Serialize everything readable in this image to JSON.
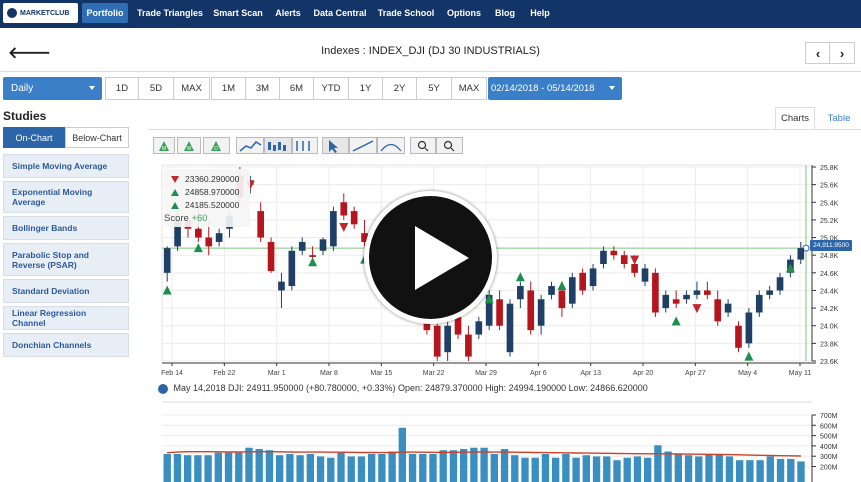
{
  "nav": {
    "logo": "MARKETCLUB",
    "items": [
      "Portfolio",
      "Trade Triangles",
      "Smart Scan",
      "Alerts",
      "Data Central",
      "Trade School",
      "Options",
      "Blog",
      "Help"
    ]
  },
  "header": {
    "title": "Indexes : INDEX_DJI (DJ 30 INDUSTRIALS)",
    "back_glyph": "🡐",
    "prev_glyph": "‹",
    "next_glyph": "›"
  },
  "range": {
    "period": "Daily",
    "buttons": [
      "1D",
      "5D",
      "MAX",
      "1M",
      "3M",
      "6M",
      "YTD",
      "1Y",
      "2Y",
      "5Y",
      "MAX"
    ],
    "date_range": "02/14/2018 - 05/14/2018"
  },
  "studies": {
    "title": "Studies",
    "tabs": [
      "On-Chart",
      "Below-Chart"
    ],
    "items": [
      "Simple Moving Average",
      "Exponential Moving Average",
      "Bollinger Bands",
      "Parabolic Stop and Reverse (PSAR)",
      "Standard Deviation",
      "Linear Regression Channel",
      "Donchian Channels"
    ]
  },
  "chart_tabs": [
    "Charts",
    "Table"
  ],
  "legend": {
    "rows": [
      "23360.290000",
      "24858.970000",
      "24185.520000"
    ],
    "score_label": "Score",
    "score_value": "+60"
  },
  "price_tag": "24,911.9500",
  "info_line": "May 14,2018 DJI: 24911.950000 (+80.780000, +0.33%) Open: 24879.370000 High: 24994.190000 Low: 24866.620000",
  "colors": {
    "nav": "#133466",
    "accent": "#3a7fc8",
    "up": "#1f3f66",
    "down": "#b5161e",
    "volume": "#3b8ec0",
    "ma": "#d0402b"
  },
  "chart_data": {
    "type": "candlestick",
    "x_ticks": [
      "Feb 14",
      "Feb 22",
      "Mar 1",
      "Mar 8",
      "Mar 15",
      "Mar 22",
      "Mar 29",
      "Apr 6",
      "Apr 13",
      "Apr 20",
      "Apr 27",
      "May 4",
      "May 11"
    ],
    "y_ticks": [
      "25.8K",
      "25.6K",
      "25.4K",
      "25.2K",
      "25.0K",
      "24.8K",
      "24.6K",
      "24.4K",
      "24.2K",
      "24.0K",
      "23.8K",
      "23.6K"
    ],
    "ylim": [
      23.6,
      25.8
    ],
    "candles": [
      {
        "o": 24.6,
        "h": 24.9,
        "l": 24.5,
        "c": 24.88
      },
      {
        "o": 24.9,
        "h": 25.3,
        "l": 24.85,
        "c": 25.2
      },
      {
        "o": 25.2,
        "h": 25.25,
        "l": 25.0,
        "c": 25.1
      },
      {
        "o": 25.1,
        "h": 25.35,
        "l": 24.95,
        "c": 25.0
      },
      {
        "o": 25.0,
        "h": 25.2,
        "l": 24.8,
        "c": 24.9
      },
      {
        "o": 24.95,
        "h": 25.1,
        "l": 24.9,
        "c": 25.05
      },
      {
        "o": 25.1,
        "h": 25.3,
        "l": 25.0,
        "c": 25.25
      },
      {
        "o": 25.7,
        "h": 25.8,
        "l": 25.4,
        "c": 25.45
      },
      {
        "o": 25.6,
        "h": 25.7,
        "l": 25.5,
        "c": 25.65
      },
      {
        "o": 25.3,
        "h": 25.4,
        "l": 24.95,
        "c": 25.0
      },
      {
        "o": 24.95,
        "h": 25.0,
        "l": 24.6,
        "c": 24.62
      },
      {
        "o": 24.4,
        "h": 24.6,
        "l": 24.2,
        "c": 24.5
      },
      {
        "o": 24.45,
        "h": 24.9,
        "l": 24.4,
        "c": 24.85
      },
      {
        "o": 24.85,
        "h": 25.0,
        "l": 24.8,
        "c": 24.95
      },
      {
        "o": 24.8,
        "h": 24.9,
        "l": 24.7,
        "c": 24.78
      },
      {
        "o": 24.85,
        "h": 25.0,
        "l": 24.8,
        "c": 24.98
      },
      {
        "o": 24.9,
        "h": 25.35,
        "l": 24.85,
        "c": 25.3
      },
      {
        "o": 25.4,
        "h": 25.5,
        "l": 25.2,
        "c": 25.25
      },
      {
        "o": 25.3,
        "h": 25.35,
        "l": 25.1,
        "c": 25.15
      },
      {
        "o": 25.05,
        "h": 25.2,
        "l": 24.9,
        "c": 24.95
      },
      {
        "o": 24.9,
        "h": 25.0,
        "l": 24.7,
        "c": 24.8
      },
      {
        "o": 24.8,
        "h": 24.95,
        "l": 24.7,
        "c": 24.9
      },
      {
        "o": 24.9,
        "h": 25.0,
        "l": 24.8,
        "c": 24.85
      },
      {
        "o": 24.7,
        "h": 24.8,
        "l": 24.6,
        "c": 24.75
      },
      {
        "o": 24.6,
        "h": 24.65,
        "l": 24.3,
        "c": 24.35
      },
      {
        "o": 24.3,
        "h": 24.4,
        "l": 23.9,
        "c": 23.95
      },
      {
        "o": 24.0,
        "h": 24.1,
        "l": 23.6,
        "c": 23.65
      },
      {
        "o": 23.7,
        "h": 24.1,
        "l": 23.6,
        "c": 24.0
      },
      {
        "o": 24.1,
        "h": 24.2,
        "l": 23.85,
        "c": 23.9
      },
      {
        "o": 23.9,
        "h": 24.0,
        "l": 23.6,
        "c": 23.65
      },
      {
        "o": 23.9,
        "h": 24.1,
        "l": 23.85,
        "c": 24.05
      },
      {
        "o": 24.0,
        "h": 24.4,
        "l": 23.95,
        "c": 24.35
      },
      {
        "o": 24.3,
        "h": 24.4,
        "l": 23.95,
        "c": 24.0
      },
      {
        "o": 23.7,
        "h": 24.3,
        "l": 23.65,
        "c": 24.25
      },
      {
        "o": 24.3,
        "h": 24.5,
        "l": 24.2,
        "c": 24.45
      },
      {
        "o": 24.4,
        "h": 24.5,
        "l": 23.9,
        "c": 23.95
      },
      {
        "o": 24.0,
        "h": 24.35,
        "l": 23.9,
        "c": 24.3
      },
      {
        "o": 24.35,
        "h": 24.5,
        "l": 24.3,
        "c": 24.45
      },
      {
        "o": 24.4,
        "h": 24.5,
        "l": 24.1,
        "c": 24.2
      },
      {
        "o": 24.25,
        "h": 24.6,
        "l": 24.2,
        "c": 24.55
      },
      {
        "o": 24.6,
        "h": 24.65,
        "l": 24.35,
        "c": 24.4
      },
      {
        "o": 24.45,
        "h": 24.7,
        "l": 24.4,
        "c": 24.65
      },
      {
        "o": 24.7,
        "h": 24.9,
        "l": 24.65,
        "c": 24.85
      },
      {
        "o": 24.85,
        "h": 24.9,
        "l": 24.75,
        "c": 24.8
      },
      {
        "o": 24.8,
        "h": 24.85,
        "l": 24.65,
        "c": 24.7
      },
      {
        "o": 24.7,
        "h": 24.8,
        "l": 24.55,
        "c": 24.6
      },
      {
        "o": 24.5,
        "h": 24.7,
        "l": 24.45,
        "c": 24.65
      },
      {
        "o": 24.6,
        "h": 24.65,
        "l": 24.1,
        "c": 24.15
      },
      {
        "o": 24.2,
        "h": 24.4,
        "l": 24.15,
        "c": 24.35
      },
      {
        "o": 24.3,
        "h": 24.4,
        "l": 24.2,
        "c": 24.25
      },
      {
        "o": 24.3,
        "h": 24.4,
        "l": 24.25,
        "c": 24.35
      },
      {
        "o": 24.35,
        "h": 24.5,
        "l": 24.3,
        "c": 24.4
      },
      {
        "o": 24.4,
        "h": 24.5,
        "l": 24.3,
        "c": 24.35
      },
      {
        "o": 24.3,
        "h": 24.4,
        "l": 24.0,
        "c": 24.05
      },
      {
        "o": 24.15,
        "h": 24.3,
        "l": 24.1,
        "c": 24.25
      },
      {
        "o": 24.0,
        "h": 24.05,
        "l": 23.7,
        "c": 23.75
      },
      {
        "o": 23.8,
        "h": 24.2,
        "l": 23.75,
        "c": 24.15
      },
      {
        "o": 24.15,
        "h": 24.4,
        "l": 24.1,
        "c": 24.35
      },
      {
        "o": 24.35,
        "h": 24.45,
        "l": 24.3,
        "c": 24.4
      },
      {
        "o": 24.4,
        "h": 24.6,
        "l": 24.35,
        "c": 24.55
      },
      {
        "o": 24.6,
        "h": 24.8,
        "l": 24.55,
        "c": 24.75
      },
      {
        "o": 24.75,
        "h": 24.95,
        "l": 24.7,
        "c": 24.88
      }
    ],
    "signals": [
      {
        "i": 0,
        "dir": "up",
        "v": 24.4
      },
      {
        "i": 3,
        "dir": "up",
        "v": 24.88
      },
      {
        "i": 7,
        "dir": "dn",
        "v": 25.65
      },
      {
        "i": 8,
        "dir": "dn",
        "v": 25.6
      },
      {
        "i": 14,
        "dir": "up",
        "v": 24.72
      },
      {
        "i": 17,
        "dir": "dn",
        "v": 25.12
      },
      {
        "i": 19,
        "dir": "up",
        "v": 24.75
      },
      {
        "i": 29,
        "dir": "dn",
        "v": 24.25
      },
      {
        "i": 31,
        "dir": "up",
        "v": 24.3
      },
      {
        "i": 34,
        "dir": "up",
        "v": 24.55
      },
      {
        "i": 38,
        "dir": "up",
        "v": 24.45
      },
      {
        "i": 45,
        "dir": "dn",
        "v": 24.75
      },
      {
        "i": 49,
        "dir": "up",
        "v": 24.05
      },
      {
        "i": 51,
        "dir": "dn",
        "v": 24.2
      },
      {
        "i": 56,
        "dir": "up",
        "v": 23.65
      },
      {
        "i": 60,
        "dir": "up",
        "v": 24.65
      }
    ],
    "volume": {
      "y_ticks": [
        "700M",
        "600M",
        "500M",
        "400M",
        "300M",
        "200M"
      ],
      "ylim": [
        200,
        700
      ],
      "values": [
        380,
        380,
        370,
        370,
        370,
        390,
        390,
        390,
        430,
        420,
        410,
        370,
        380,
        370,
        380,
        360,
        350,
        390,
        360,
        360,
        380,
        380,
        400,
        590,
        380,
        380,
        380,
        410,
        410,
        420,
        430,
        430,
        380,
        420,
        370,
        350,
        350,
        380,
        350,
        380,
        350,
        370,
        360,
        360,
        330,
        350,
        360,
        350,
        450,
        400,
        380,
        370,
        360,
        380,
        380,
        360,
        330,
        330,
        330,
        360,
        340,
        340,
        320
      ],
      "ma": [
        390,
        395,
        398,
        398,
        398,
        397,
        396,
        396,
        397,
        398,
        398,
        397,
        396,
        395,
        395,
        395,
        394,
        394,
        393,
        392,
        392,
        391,
        391,
        395,
        395,
        394,
        393,
        393,
        393,
        394,
        395,
        396,
        395,
        395,
        394,
        393,
        392,
        391,
        390,
        389,
        388,
        387,
        386,
        385,
        384,
        383,
        382,
        381,
        381,
        381,
        380,
        379,
        378,
        377,
        376,
        375,
        373,
        371,
        369,
        368,
        366,
        365,
        364
      ]
    }
  }
}
